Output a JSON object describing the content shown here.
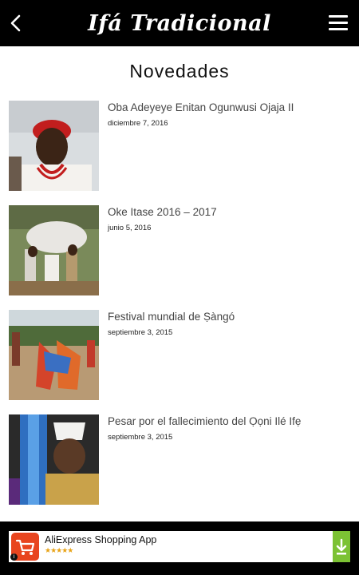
{
  "header": {
    "title": "Ifá Tradicional",
    "back_icon": "back-chevron-icon",
    "menu_icon": "hamburger-menu-icon"
  },
  "main": {
    "section_title": "Novedades",
    "posts": [
      {
        "title": "Oba Adeyeye Enitan Ogunwusi Ojaja II",
        "date": "diciembre 7, 2016"
      },
      {
        "title": "Oke Itase 2016 – 2017",
        "date": "junio 5, 2016"
      },
      {
        "title": "Festival mundial de Ṣàngó",
        "date": "septiembre 3, 2015"
      },
      {
        "title": "Pesar por el fallecimiento del Ọọni Ilé Ifẹ",
        "date": "septiembre 3, 2015"
      }
    ]
  },
  "ad": {
    "app_name": "AliExpress Shopping App",
    "stars": "★★★★★",
    "info_label": "i",
    "icon": "shopping-cart-icon",
    "download_icon": "download-icon",
    "colors": {
      "icon_bg": "#e8451f",
      "download_bg": "#7cc234"
    }
  },
  "colors": {
    "topbar": "#000000",
    "background": "#ffffff"
  }
}
